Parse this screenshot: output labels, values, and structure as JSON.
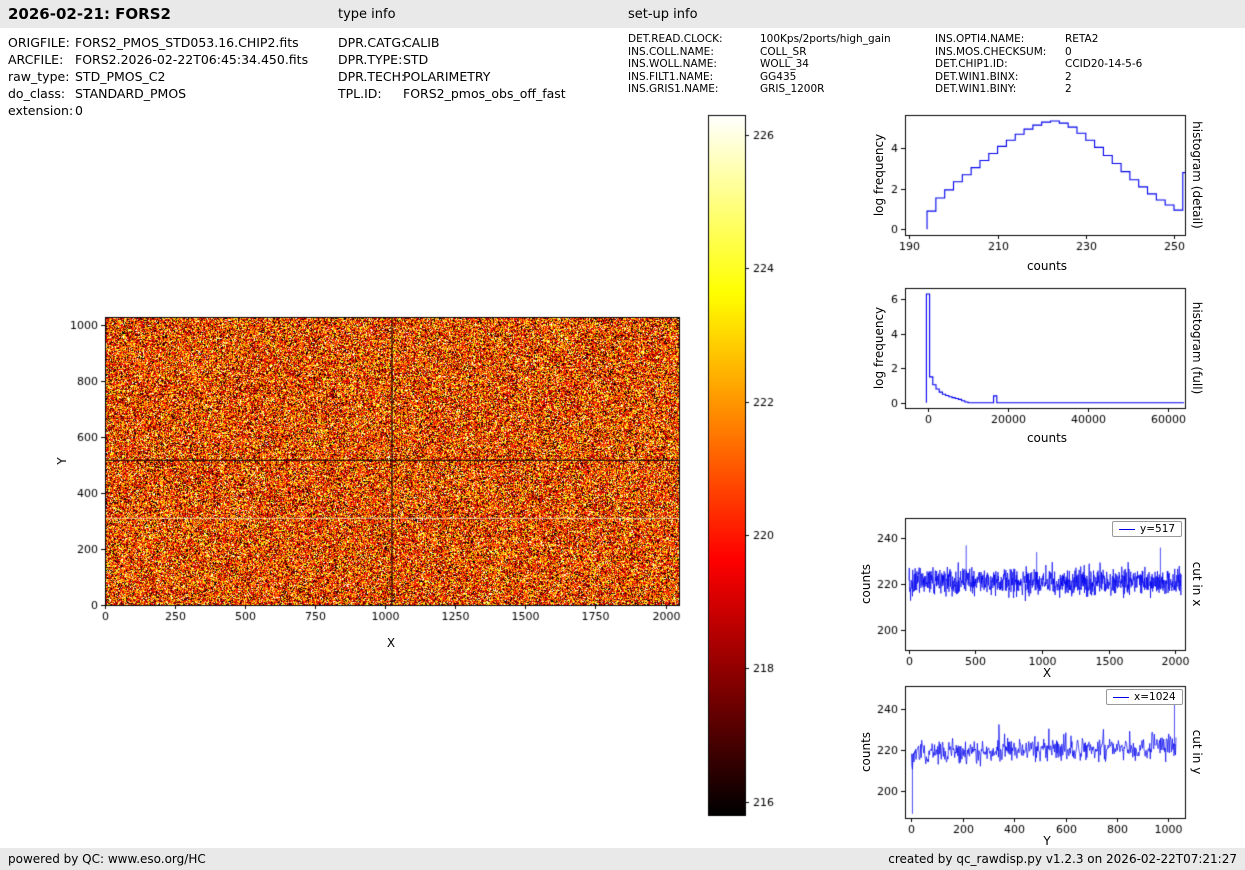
{
  "header": {
    "title": "2026-02-21: FORS2",
    "type_info_label": "type info",
    "setup_info_label": "set-up info"
  },
  "file_info": {
    "rows": [
      {
        "label": "ORIGFILE:",
        "value": "FORS2_PMOS_STD053.16.CHIP2.fits"
      },
      {
        "label": "ARCFILE:",
        "value": "FORS2.2026-02-22T06:45:34.450.fits"
      },
      {
        "label": "raw_type:",
        "value": "STD_PMOS_C2"
      },
      {
        "label": "do_class:",
        "value": "STANDARD_PMOS"
      },
      {
        "label": "extension:",
        "value": "0"
      }
    ]
  },
  "type_info": {
    "rows": [
      {
        "label": "DPR.CATG:",
        "value": "CALIB"
      },
      {
        "label": "DPR.TYPE:",
        "value": "STD"
      },
      {
        "label": "DPR.TECH:",
        "value": "POLARIMETRY"
      },
      {
        "label": "TPL.ID:",
        "value": "FORS2_pmos_obs_off_fast"
      }
    ]
  },
  "setup_info": {
    "col1": [
      {
        "label": "DET.READ.CLOCK:",
        "value": "100Kps/2ports/high_gain"
      },
      {
        "label": "INS.COLL.NAME:",
        "value": "COLL_SR"
      },
      {
        "label": "INS.WOLL.NAME:",
        "value": "WOLL_34"
      },
      {
        "label": "INS.FILT1.NAME:",
        "value": "GG435"
      },
      {
        "label": "INS.GRIS1.NAME:",
        "value": "GRIS_1200R"
      }
    ],
    "col2": [
      {
        "label": "INS.OPTI4.NAME:",
        "value": "RETA2"
      },
      {
        "label": "INS.MOS.CHECKSUM:",
        "value": "0"
      },
      {
        "label": "DET.CHIP1.ID:",
        "value": "CCID20-14-5-6"
      },
      {
        "label": "DET.WIN1.BINX:",
        "value": "2"
      },
      {
        "label": "DET.WIN1.BINY:",
        "value": "2"
      }
    ]
  },
  "footer": {
    "left": "powered by QC: www.eso.org/HC",
    "right": "created by qc_rawdisp.py v1.2.3 on 2026-02-22T07:21:27"
  },
  "colors": {
    "line_blue": "#0000ee",
    "bar_bg": "#e9e9e9",
    "axis_black": "#000000"
  },
  "chart_data": [
    {
      "id": "raster",
      "type": "heatmap",
      "xlabel": "X",
      "ylabel": "Y",
      "xlim": [
        0,
        2048
      ],
      "ylim": [
        0,
        1030
      ],
      "xticks": [
        0,
        250,
        500,
        750,
        1000,
        1250,
        1500,
        1750,
        2000
      ],
      "yticks": [
        0,
        200,
        400,
        600,
        800,
        1000
      ],
      "colormap": "hot",
      "vmin": 216,
      "vmax": 226,
      "noise_mean": 220.5,
      "noise_std": 2.8,
      "features": {
        "dark_column_x": 1024,
        "dark_row_y": 517,
        "bright_row_y": 310
      }
    },
    {
      "id": "colorbar",
      "type": "colorbar",
      "colormap": "hot",
      "ticks": [
        216,
        218,
        220,
        222,
        224,
        226
      ],
      "range": [
        215.8,
        226.3
      ]
    },
    {
      "id": "hist_detail",
      "type": "line",
      "style": "step-histogram",
      "right_label": "histogram (detail)",
      "xlabel": "counts",
      "ylabel": "log frequency",
      "xlim": [
        189,
        252.5
      ],
      "ylim": [
        -0.28,
        5.65
      ],
      "xticks": [
        190,
        210,
        230,
        250
      ],
      "yticks": [
        0,
        2,
        4
      ],
      "bin_edges": [
        194,
        196,
        198,
        200,
        202,
        204,
        206,
        208,
        210,
        212,
        214,
        216,
        218,
        220,
        222,
        224,
        226,
        228,
        230,
        232,
        234,
        236,
        238,
        240,
        242,
        244,
        246,
        248,
        250,
        252,
        254
      ],
      "log_freq": [
        0.9,
        1.55,
        1.95,
        2.35,
        2.7,
        3.05,
        3.4,
        3.75,
        4.1,
        4.4,
        4.7,
        4.95,
        5.15,
        5.3,
        5.35,
        5.25,
        5.05,
        4.75,
        4.4,
        4.05,
        3.65,
        3.25,
        2.85,
        2.45,
        2.1,
        1.75,
        1.45,
        1.2,
        0.95,
        2.8
      ]
    },
    {
      "id": "hist_full",
      "type": "line",
      "style": "step-histogram",
      "right_label": "histogram (full)",
      "xlabel": "counts",
      "ylabel": "log frequency",
      "xlim": [
        -5750,
        64250
      ],
      "ylim": [
        -0.3,
        6.65
      ],
      "xticks": [
        0,
        20000,
        40000,
        60000
      ],
      "yticks": [
        0,
        2,
        4,
        6
      ],
      "bin_edges": [
        -400,
        400,
        1200,
        2000,
        2800,
        3600,
        4400,
        5200,
        6000,
        6800,
        7600,
        8400,
        9200,
        10000,
        16400,
        17200,
        64000
      ],
      "log_freq": [
        6.3,
        1.5,
        1.05,
        0.8,
        0.62,
        0.5,
        0.42,
        0.35,
        0.3,
        0.25,
        0.2,
        0.12,
        0.05,
        0,
        0.4,
        0
      ]
    },
    {
      "id": "cut_x",
      "type": "line",
      "right_label": "cut in x",
      "xlabel": "X",
      "ylabel": "counts",
      "legend": "y=517",
      "xlim": [
        -30,
        2075
      ],
      "ylim": [
        191,
        249
      ],
      "xticks": [
        0,
        500,
        1000,
        1500,
        2000
      ],
      "yticks": [
        200,
        220,
        240
      ],
      "mean": 221,
      "std": 3.0,
      "n": 1024,
      "x_max": 2048,
      "spikes": [
        {
          "x": 430,
          "y": 237
        },
        {
          "x": 960,
          "y": 234
        },
        {
          "x": 1890,
          "y": 236
        }
      ]
    },
    {
      "id": "cut_y",
      "type": "line",
      "right_label": "cut in y",
      "xlabel": "Y",
      "ylabel": "counts",
      "legend": "x=1024",
      "xlim": [
        -25,
        1065
      ],
      "ylim": [
        187,
        251
      ],
      "xticks": [
        0,
        200,
        400,
        600,
        800,
        1000
      ],
      "yticks": [
        200,
        220,
        240
      ],
      "mean_start": 218,
      "mean_end": 222,
      "std": 3.0,
      "n": 515,
      "x_max": 1030,
      "spikes": [
        {
          "x": 4,
          "y": 189
        },
        {
          "x": 1024,
          "y": 243
        }
      ]
    }
  ]
}
